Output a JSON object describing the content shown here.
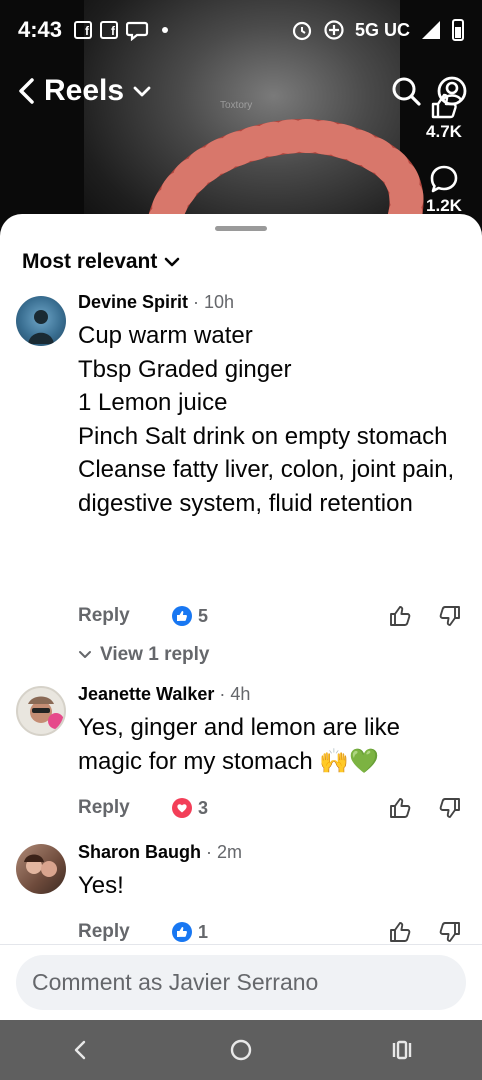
{
  "status_bar": {
    "time": "4:43",
    "network": "5G UC"
  },
  "reels_header": {
    "title": "Reels",
    "video_watermark": "Toxtory"
  },
  "side_actions": {
    "like_count": "4.7K",
    "comment_count": "1.2K"
  },
  "comments_sheet": {
    "sort_label": "Most relevant",
    "comments": [
      {
        "author": "Devine Spirit",
        "time": "10h",
        "text": "Cup warm water\nTbsp Graded ginger\n1 Lemon juice\nPinch Salt drink on empty stomach\nCleanse fatty liver, colon, joint pain, digestive system, fluid retention",
        "reply_label": "Reply",
        "reaction_type": "like",
        "reaction_count": "5",
        "view_replies_label": "View 1 reply"
      },
      {
        "author": "Jeanette Walker",
        "time": "4h",
        "text": "Yes, ginger and lemon are like magic for my stomach 🙌💚",
        "reply_label": "Reply",
        "reaction_type": "love",
        "reaction_count": "3"
      },
      {
        "author": "Sharon Baugh",
        "time": "2m",
        "text": "Yes!",
        "reply_label": "Reply",
        "reaction_type": "like",
        "reaction_count": "1"
      }
    ],
    "composer_placeholder": "Comment as Javier Serrano"
  },
  "colors": {
    "like_blue": "#1877f2",
    "love_red": "#f33e58",
    "secondary_text": "#65676b",
    "nav_bar": "#5f5f5f"
  }
}
